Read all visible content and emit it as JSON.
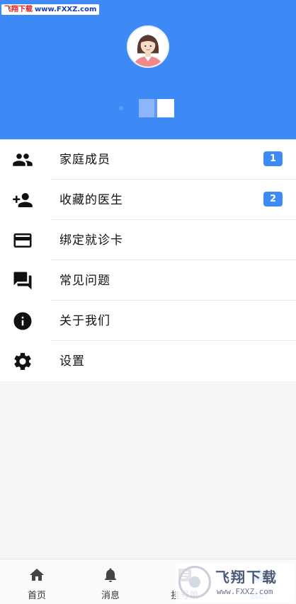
{
  "watermark_top": {
    "brand": "飞翔下载",
    "url": "www.FXXZ.com"
  },
  "menu": {
    "items": [
      {
        "icon": "people-icon",
        "label": "家庭成员",
        "badge": "1"
      },
      {
        "icon": "person-add-icon",
        "label": "收藏的医生",
        "badge": "2"
      },
      {
        "icon": "card-icon",
        "label": "绑定就诊卡"
      },
      {
        "icon": "chat-icon",
        "label": "常见问题"
      },
      {
        "icon": "info-icon",
        "label": "关于我们"
      },
      {
        "icon": "gear-icon",
        "label": "设置"
      }
    ]
  },
  "tabbar": {
    "tabs": [
      {
        "icon": "home-icon",
        "label": "首页"
      },
      {
        "icon": "bell-icon",
        "label": "消息"
      },
      {
        "icon": "ticket-icon",
        "label": "挂号单"
      },
      {
        "icon": "user-icon",
        "label": "我的",
        "active": true
      }
    ]
  },
  "watermark_bottom": {
    "title": "飞翔下载",
    "url": "www.FXXZ.com"
  },
  "colors": {
    "primary": "#3d8af7",
    "background": "#f6f5f8"
  }
}
